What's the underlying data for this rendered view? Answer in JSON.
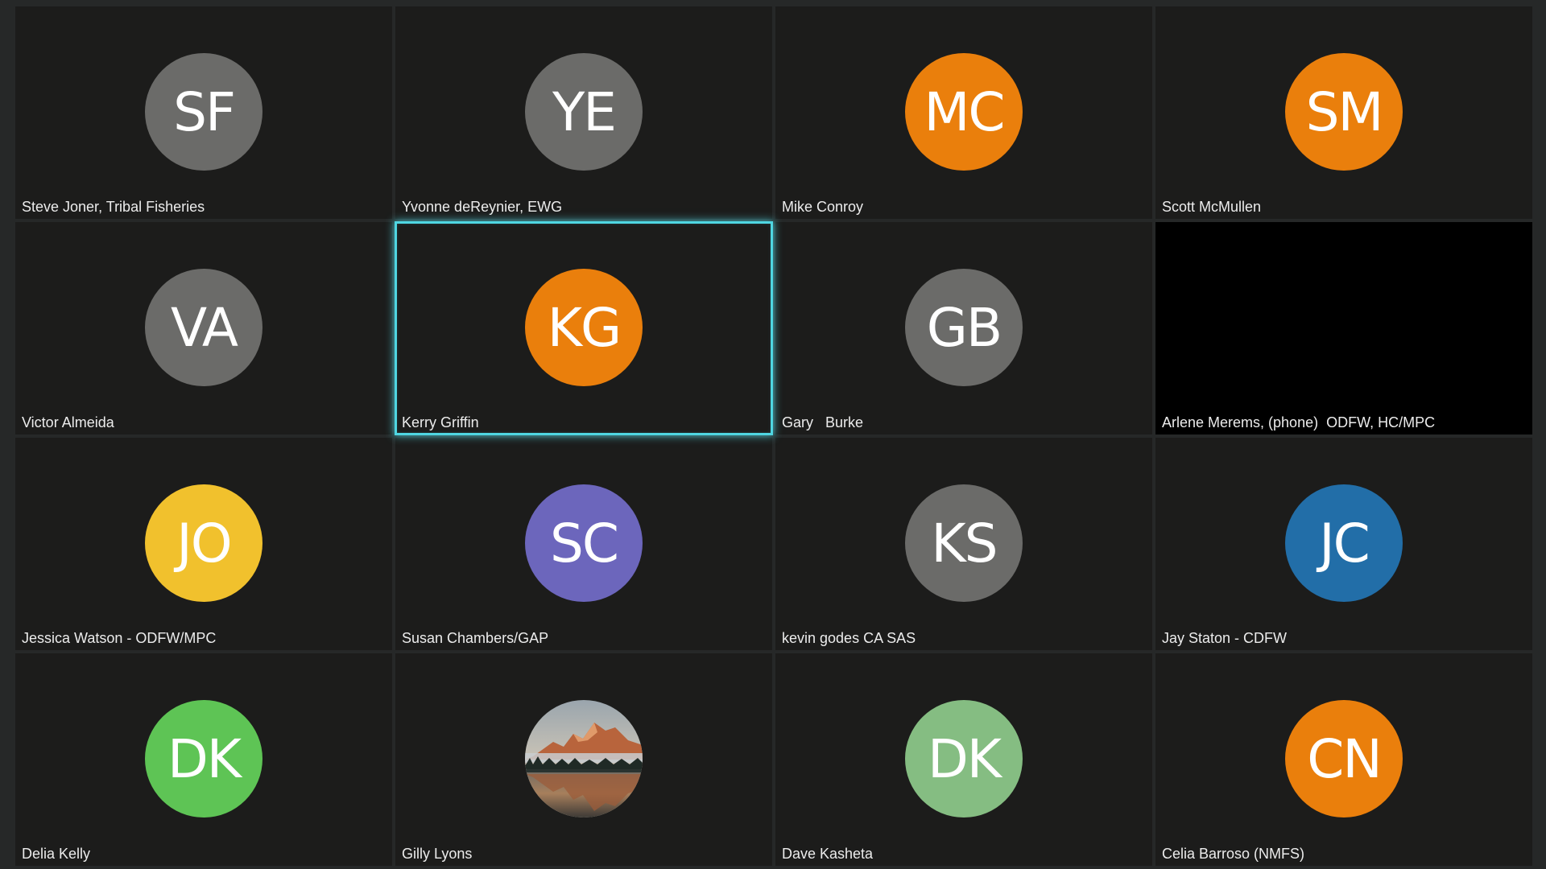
{
  "participants": [
    {
      "name": "Steve Joner, Tribal Fisheries",
      "initials": "SF",
      "color": "#6b6b69"
    },
    {
      "name": "Yvonne deReynier, EWG",
      "initials": "YE",
      "color": "#6b6b69"
    },
    {
      "name": "Mike Conroy",
      "initials": "MC",
      "color": "#ea7f0c"
    },
    {
      "name": "Scott McMullen",
      "initials": "SM",
      "color": "#ea7f0c"
    },
    {
      "name": "Victor Almeida",
      "initials": "VA",
      "color": "#6b6b69"
    },
    {
      "name": "Kerry Griffin",
      "initials": "KG",
      "color": "#ea7f0c",
      "speaking": true
    },
    {
      "name": "Gary   Burke",
      "initials": "GB",
      "color": "#6b6b69"
    },
    {
      "name": "Arlene Merems, (phone)  ODFW, HC/MPC",
      "no_video": true
    },
    {
      "name": "Jessica Watson - ODFW/MPC",
      "initials": "JO",
      "color": "#f1c12d"
    },
    {
      "name": "Susan Chambers/GAP",
      "initials": "SC",
      "color": "#6c66bc"
    },
    {
      "name": "kevin godes CA SAS",
      "initials": "KS",
      "color": "#6b6b69"
    },
    {
      "name": "Jay Staton - CDFW",
      "initials": "JC",
      "color": "#226ea8"
    },
    {
      "name": "Delia Kelly",
      "initials": "DK",
      "color": "#5ec455"
    },
    {
      "name": "Gilly Lyons",
      "avatar_image": "mountain-lake-photo"
    },
    {
      "name": "Dave Kasheta",
      "initials": "DK",
      "color": "#85bd82"
    },
    {
      "name": "Celia Barroso (NMFS)",
      "initials": "CN",
      "color": "#ea7f0c"
    }
  ],
  "theme": {
    "speaking_outline": "#4fd6e2",
    "tile_background": "#1c1c1b",
    "page_background": "#262828"
  }
}
